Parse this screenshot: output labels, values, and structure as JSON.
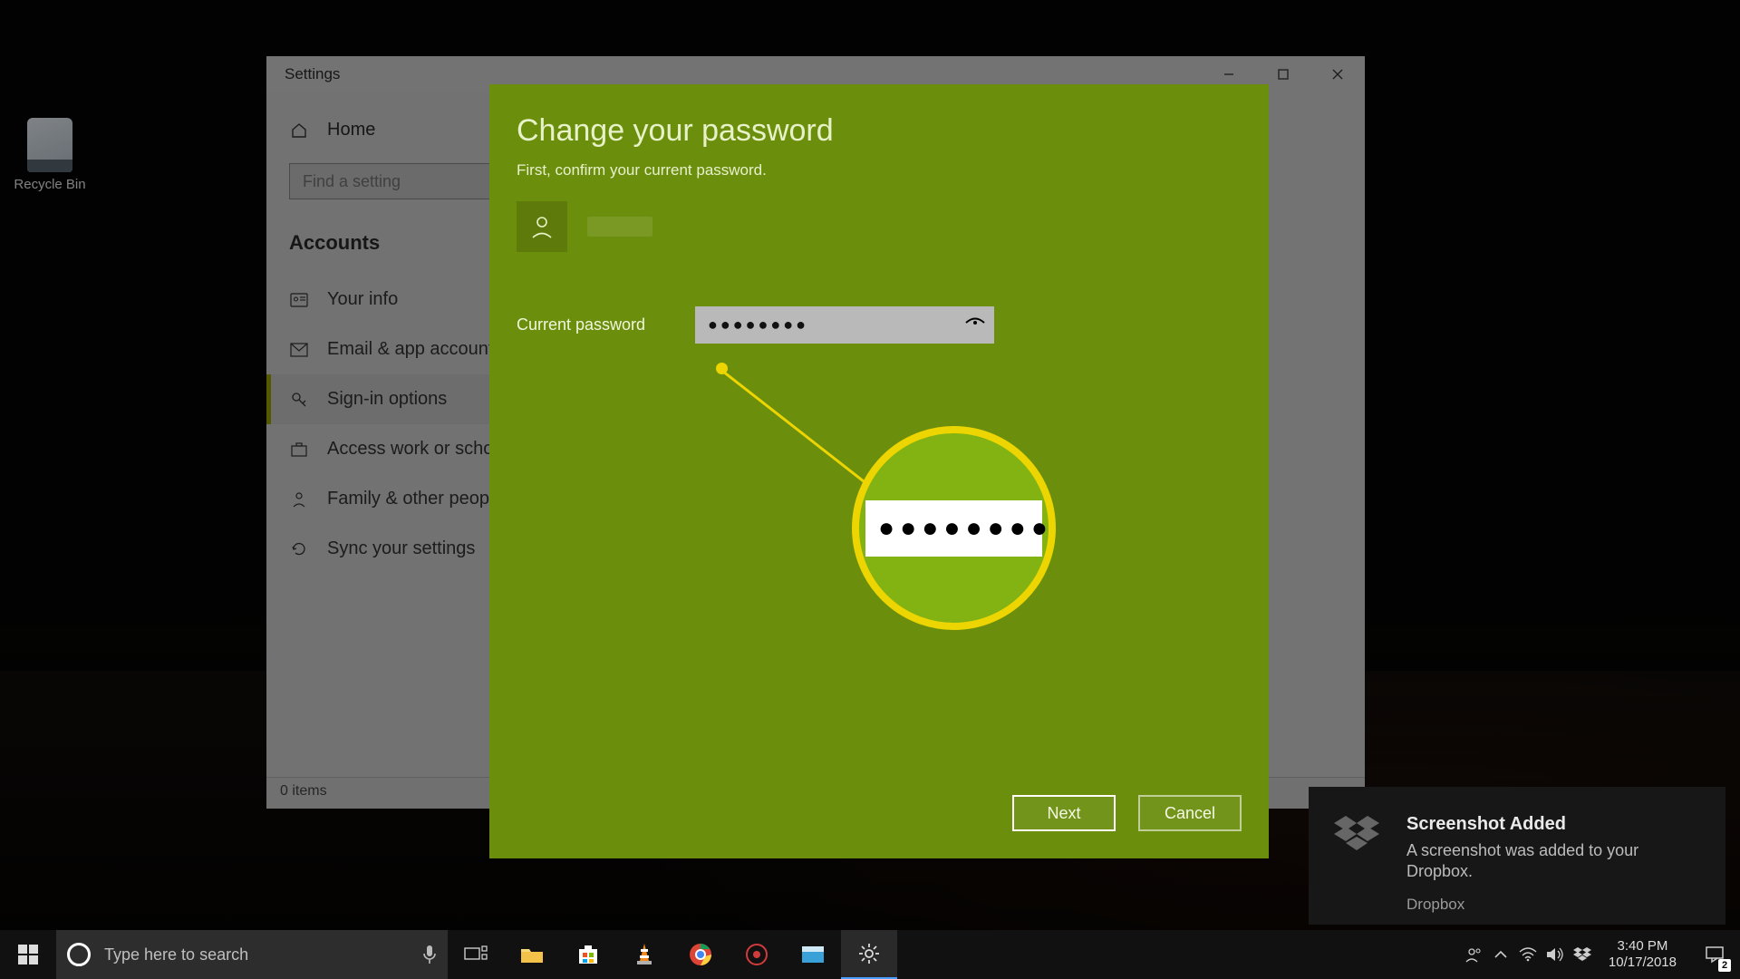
{
  "desktop": {
    "recycle_bin_label": "Recycle Bin"
  },
  "settings_window": {
    "title": "Settings",
    "home_label": "Home",
    "search_placeholder": "Find a setting",
    "heading": "Accounts",
    "items": [
      {
        "label": "Your info",
        "icon": "user-card-icon"
      },
      {
        "label": "Email & app accounts",
        "icon": "mail-icon"
      },
      {
        "label": "Sign-in options",
        "icon": "key-icon",
        "selected": true
      },
      {
        "label": "Access work or school",
        "icon": "briefcase-icon"
      },
      {
        "label": "Family & other people",
        "icon": "people-icon"
      },
      {
        "label": "Sync your settings",
        "icon": "sync-icon"
      }
    ],
    "status_text": "0 items"
  },
  "change_password": {
    "title": "Change your password",
    "subtitle": "First, confirm your current password.",
    "current_password_label": "Current password",
    "password_mask": "●●●●●●●●",
    "zoom_mask": "●●●●●●●●",
    "next_label": "Next",
    "cancel_label": "Cancel"
  },
  "toast": {
    "title": "Screenshot Added",
    "body": "A screenshot was added to your Dropbox.",
    "app": "Dropbox"
  },
  "taskbar": {
    "search_placeholder": "Type here to search",
    "time": "3:40 PM",
    "date": "10/17/2018",
    "notif_count": "2"
  }
}
